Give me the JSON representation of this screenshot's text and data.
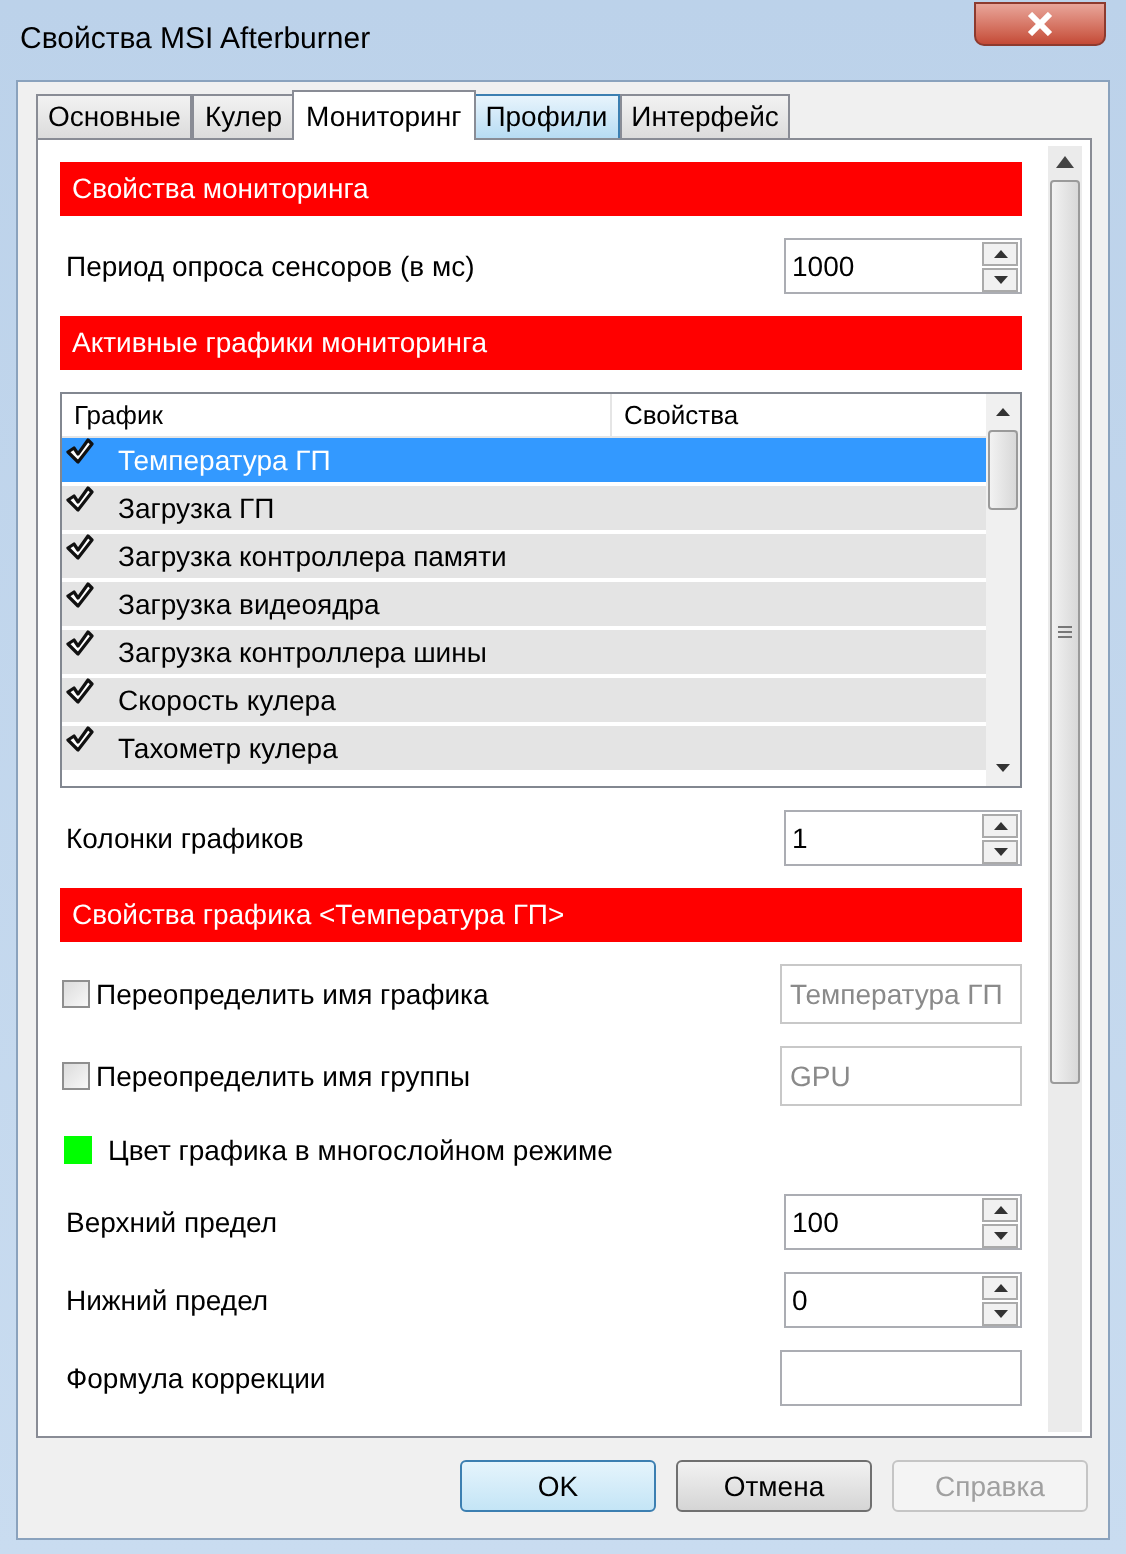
{
  "window": {
    "title": "Свойства MSI Afterburner"
  },
  "tabs": [
    {
      "label": "Основные",
      "selected": false,
      "hover": false
    },
    {
      "label": "Кулер",
      "selected": false,
      "hover": false
    },
    {
      "label": "Мониторинг",
      "selected": true,
      "hover": false
    },
    {
      "label": "Профили",
      "selected": false,
      "hover": true
    },
    {
      "label": "Интерфейс",
      "selected": false,
      "hover": false
    }
  ],
  "panel": [
    {
      "kind": "header",
      "label": "Свойства мониторинга"
    },
    {
      "kind": "spin",
      "label": "Период опроса сенсоров (в мс)",
      "value": "1000"
    },
    {
      "kind": "header",
      "label": "Активные графики мониторинга"
    },
    {
      "kind": "list",
      "columns": [
        "График",
        "Свойства"
      ],
      "rows": [
        {
          "label": "Температура ГП",
          "checked": true,
          "selected": true
        },
        {
          "label": "Загрузка ГП",
          "checked": true,
          "selected": false
        },
        {
          "label": "Загрузка контроллера памяти",
          "checked": true,
          "selected": false
        },
        {
          "label": "Загрузка видеоядра",
          "checked": true,
          "selected": false
        },
        {
          "label": "Загрузка контроллера шины",
          "checked": true,
          "selected": false
        },
        {
          "label": "Скорость кулера",
          "checked": true,
          "selected": false
        },
        {
          "label": "Тахометр кулера",
          "checked": true,
          "selected": false
        }
      ]
    },
    {
      "kind": "spin",
      "label": "Колонки графиков",
      "value": "1"
    },
    {
      "kind": "header",
      "label": "Свойства графика <Температура ГП>"
    },
    {
      "kind": "checkfield",
      "label": "Переопределить имя графика",
      "checked": false,
      "value": "Температура ГП",
      "disabled": true
    },
    {
      "kind": "checkfield",
      "label": "Переопределить имя группы",
      "checked": false,
      "value": "GPU",
      "disabled": true
    },
    {
      "kind": "color",
      "label": "Цвет графика в многослойном режиме",
      "color": "#00ff00"
    },
    {
      "kind": "spin",
      "label": "Верхний предел",
      "value": "100"
    },
    {
      "kind": "spin",
      "label": "Нижний предел",
      "value": "0"
    },
    {
      "kind": "field",
      "label": "Формула коррекции"
    }
  ],
  "buttons": [
    {
      "label": "OK",
      "default": true,
      "disabled": false
    },
    {
      "label": "Отмена",
      "default": false,
      "disabled": false
    },
    {
      "label": "Справка",
      "default": false,
      "disabled": true
    }
  ]
}
